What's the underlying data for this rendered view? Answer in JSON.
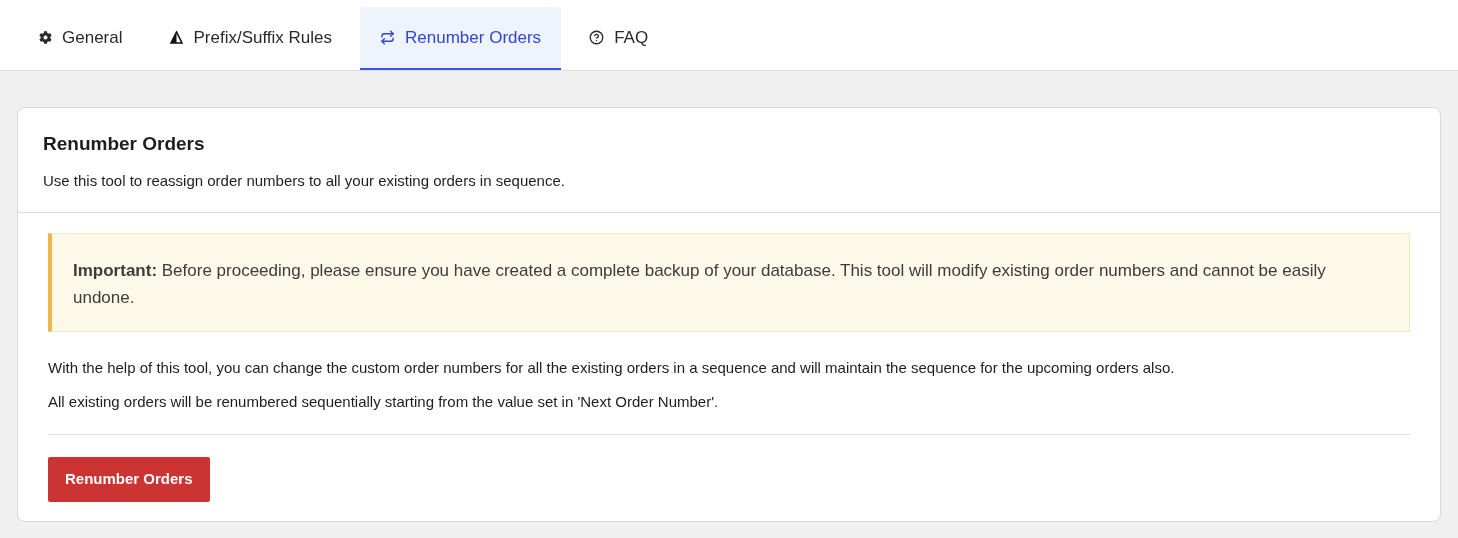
{
  "tabs": [
    {
      "label": "General",
      "selected": false
    },
    {
      "label": "Prefix/Suffix Rules",
      "selected": false
    },
    {
      "label": "Renumber Orders",
      "selected": true
    },
    {
      "label": "FAQ",
      "selected": false
    }
  ],
  "card": {
    "title": "Renumber Orders",
    "description": "Use this tool to reassign order numbers to all your existing orders in sequence.",
    "notice": "**Important:** Before proceeding, please ensure you have created a complete backup of your database. This tool will modify existing order numbers and cannot be easily undone.",
    "paragraphs": [
      "With the help of this tool, you can change the custom order numbers for all the existing orders in a sequence and will maintain the sequence for the upcoming orders also.",
      "All existing orders will be renumbered sequentially starting from the value set in 'Next Order Number'."
    ],
    "button": "Renumber Orders"
  }
}
